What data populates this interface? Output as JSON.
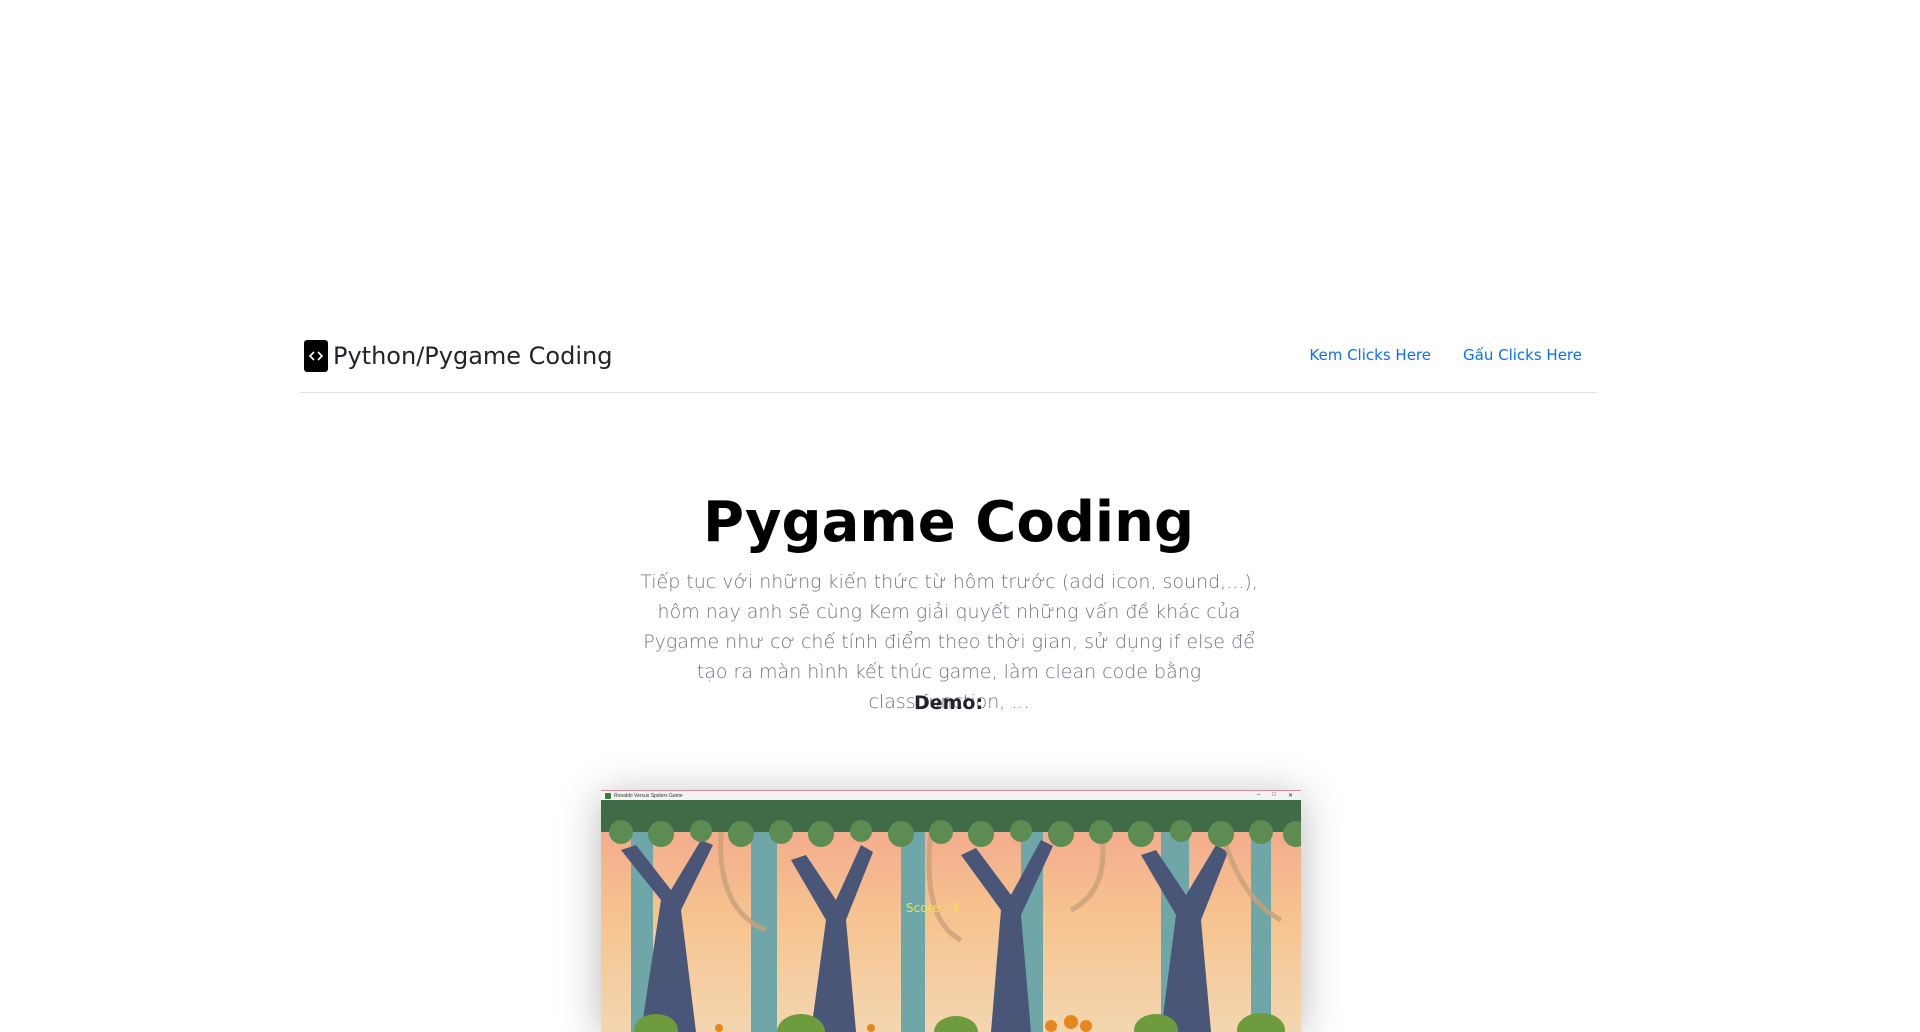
{
  "navbar": {
    "brand": "Python/Pygame Coding",
    "brand_icon": "code-icon",
    "links": [
      {
        "label": "Kem Clicks Here"
      },
      {
        "label": "Gấu Clicks Here"
      }
    ],
    "link_color": "#0d6efd"
  },
  "hero": {
    "title": "Pygame Coding",
    "description": "Tiếp tục với những kiến thức từ hôm trước (add icon, sound,...), hôm nay anh sẽ cùng Kem giải quyết những vấn đề khác của Pygame như cơ chế tính điểm theo thời gian, sử dụng if else để tạo ra màn hình kết thúc game, làm clean code bằng class,function, ...",
    "demo_label": "Demo:"
  },
  "demo_window": {
    "title": "Ronaldo Versus Spiders Game",
    "controls": [
      "–",
      "□",
      "✕"
    ],
    "score_text": "Score : 3"
  }
}
